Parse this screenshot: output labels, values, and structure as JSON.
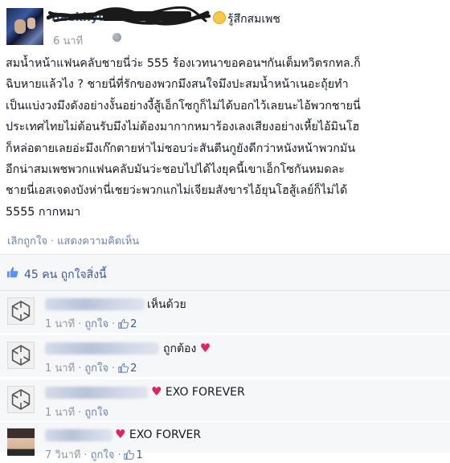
{
  "post": {
    "author": "Baekhyun",
    "feeling": "รู้สึกสมเพช",
    "time": "6 นาที",
    "body_lines": [
      "สมน้ำหน้าแฟนคลับชายนี่ว่ะ 555 ร้องเวทนาขอคอนฯกันเต็มทวิตรกทล.ก็",
      "ฉิบหายแล้วไง ? ชายนี่ที่รักของพวกมึงสนใจมึงปะสมน้ำหน้าเนอะถุ้ยทำ",
      "เป็นแบ่งวงมึงดังอย่างงั้นอย่างงี้สู้เอ็กโซกูก็ไม่ได้บอกไว้เลยนะไอ้พวกชายนี่",
      "ประเทศไทยไม่ต้อนรับมึงไม่ต้องมากากหมาร้องเลงเสียงอย่างเหี้ยไอ้มินโฮ",
      "ก็หล่อตายเลยอ่ะมึงเก๊กตายห่าไม่ชอบว่ะสันตีนกูยังดีกว่าหนังหน้าพวกมัน",
      "อีกน่าสมเพชพวกแฟนคลับมันว่ะชอบไปได้ไงยุคนี้เขาเอ็กโซกันหมดละ",
      "ชายนี่เอสเจดงบังห่านี่เชยว่ะพวกแกไม่เจียมสังขารไอ้ยุนโฮสู้เลย์ก็ไม่ได้",
      "5555 กากหมา"
    ],
    "actions": {
      "unlike": "เลิกถูกใจ",
      "separator": "·",
      "show_comments": "แสดงความคิดเห็น"
    }
  },
  "likes": {
    "count": "45",
    "text": "คน ถูกใจสิ่งนี้"
  },
  "comments": [
    {
      "text": "เห็นด้วย",
      "heart": "",
      "time": "1 นาที",
      "like_label": "ถูกใจ",
      "like_count": "2",
      "avatar": "exo-logo"
    },
    {
      "text": "ถูกต้อง",
      "heart": "♥",
      "time": "1 นาที",
      "like_label": "ถูกใจ",
      "like_count": "2",
      "avatar": "exo-logo"
    },
    {
      "text": "EXO FOREVER",
      "heart": "♥",
      "time": "1 นาที",
      "like_label": "ถูกใจ",
      "like_count": "",
      "avatar": "exo-logo"
    },
    {
      "text": "EXO FORVER",
      "heart": "♥",
      "time": "7 วินาที",
      "like_label": "ถูกใจ",
      "like_count": "1",
      "avatar": "photo"
    }
  ],
  "colors": {
    "link": "#3b5998",
    "muted": "#9197a3",
    "heart": "#e0245e",
    "comment_bg": "#f6f7f8"
  }
}
